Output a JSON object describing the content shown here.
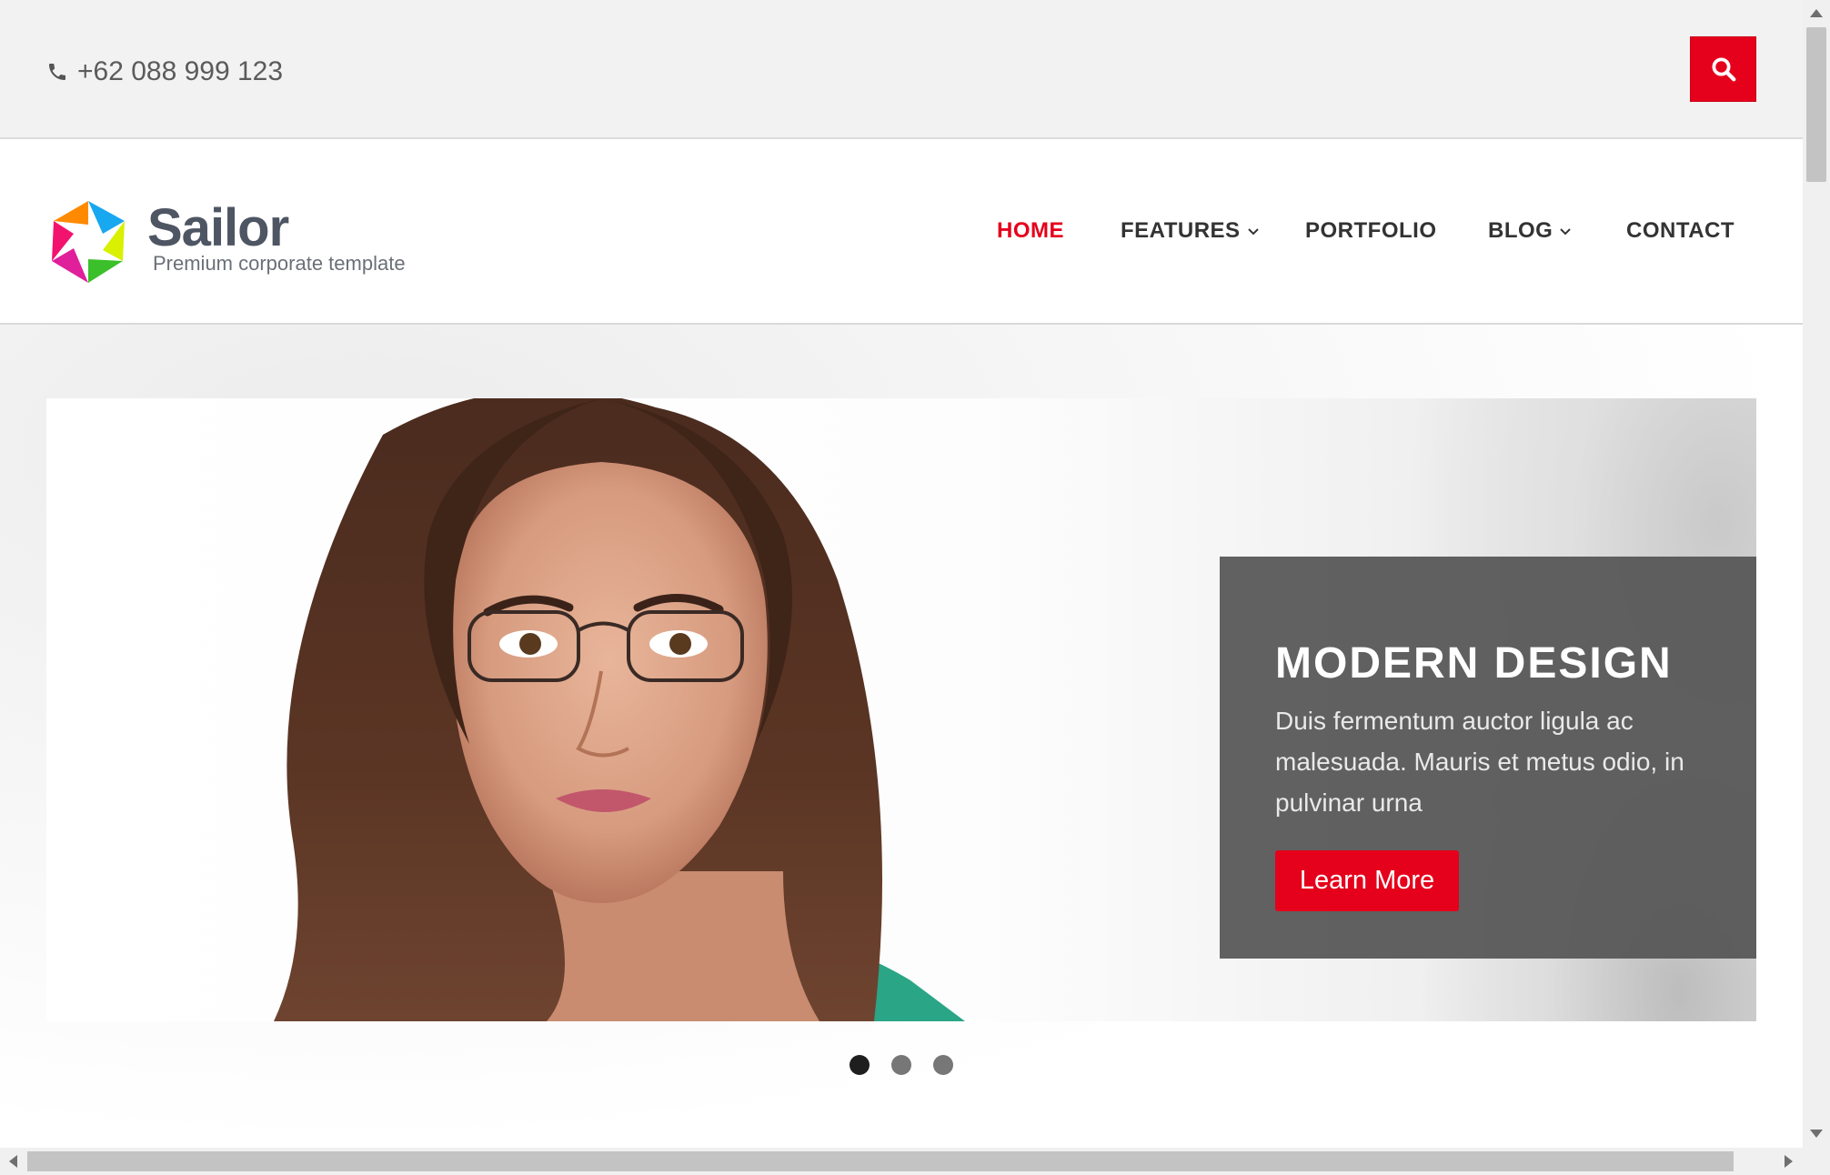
{
  "topbar": {
    "phone": "+62 088 999 123",
    "phone_icon": "phone-icon",
    "search_icon": "search-icon"
  },
  "brand": {
    "name": "Sailor",
    "tagline": "Premium corporate template"
  },
  "nav": {
    "items": [
      {
        "label": "HOME",
        "active": true
      },
      {
        "label": "FEATURES",
        "has_dropdown": true
      },
      {
        "label": "PORTFOLIO"
      },
      {
        "label": "BLOG",
        "has_dropdown": true
      },
      {
        "label": "CONTACT"
      }
    ]
  },
  "hero": {
    "title": "MODERN DESIGN",
    "text": "Duis fermentum auctor ligula ac malesuada. Mauris et metus odio, in pulvinar urna",
    "button": "Learn More",
    "slides_count": 3,
    "active_slide": 1
  },
  "colors": {
    "accent": "#e5001b",
    "text": "#333333",
    "brand": "#4e5563",
    "caption_bg": "#555555"
  }
}
